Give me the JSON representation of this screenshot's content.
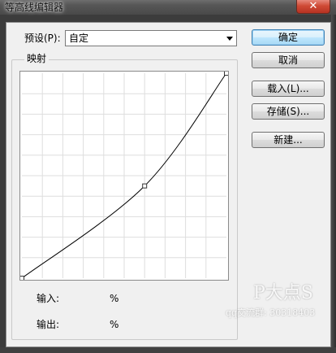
{
  "window": {
    "title": "等高线编辑器",
    "close_glyph": "✕"
  },
  "preset": {
    "label": "预设(P):",
    "value": "自定"
  },
  "mapping": {
    "legend": "映射",
    "input_label": "输入:",
    "input_unit": "%",
    "output_label": "输出:",
    "output_unit": "%"
  },
  "buttons": {
    "ok": "确定",
    "cancel": "取消",
    "load": "载入(L)...",
    "save": "存储(S)...",
    "new": "新建..."
  },
  "curve": {
    "grid_divisions": 10,
    "points": [
      {
        "input": 0,
        "output": 0
      },
      {
        "input": 60,
        "output": 45
      },
      {
        "input": 100,
        "output": 100
      }
    ]
  },
  "watermark": {
    "text": "P大点S",
    "sub_text": "qq交流群: 30318403"
  },
  "colors": {
    "close_button": "#c7402d",
    "default_button": "#bee6fd",
    "curve_line": "#000000",
    "grid_line": "#dedede"
  }
}
